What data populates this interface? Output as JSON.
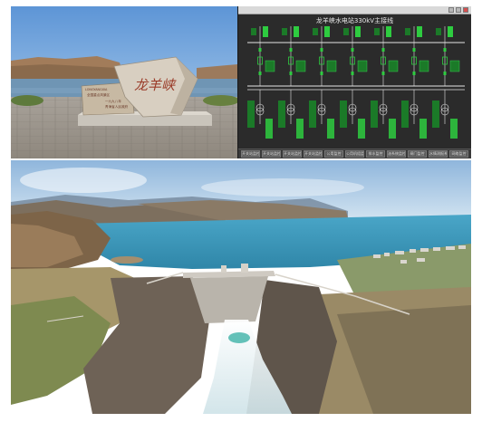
{
  "monument": {
    "main_inscription": "龙羊峡",
    "small_stone_lines": [
      "LONGYANGXIA",
      "全国重点风景区",
      "一九九八年",
      "青海省人民政府"
    ]
  },
  "scada": {
    "title": "龙羊峡水电站330kV主接线",
    "bottom_buttons": [
      "开关站监控",
      "开关站监控",
      "开关站监控",
      "开关站监控",
      "公用监控",
      "公用机组监控",
      "排水监控",
      "油系统监控",
      "闸门监控",
      "水情测报系统",
      "网络监控"
    ],
    "window_buttons": [
      "minimize-icon",
      "maximize-icon",
      "close-icon"
    ]
  },
  "colors": {
    "scada_background": "#2b2b2b",
    "scada_line": "#e6e6e6",
    "scada_green": "#2ecc40",
    "sky": "#9cc5e8",
    "reservoir": "#3b9ec4"
  }
}
